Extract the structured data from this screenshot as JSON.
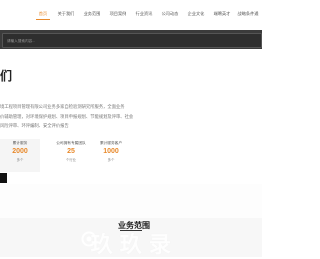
{
  "nav": {
    "items": [
      {
        "label": "首页",
        "active": true
      },
      {
        "label": "关于我们"
      },
      {
        "label": "业务范围"
      },
      {
        "label": "项目案例"
      },
      {
        "label": "行业资讯"
      },
      {
        "label": "公司动态"
      },
      {
        "label": "企业文化"
      },
      {
        "label": "端聘英才"
      },
      {
        "label": "战略条件通"
      }
    ]
  },
  "search": {
    "placeholder": "请输入搜索内容..."
  },
  "about": {
    "title": "们",
    "lines": [
      "境工程项目管理有限公司业务多家自检验测研究所服务，全面业务",
      "价辅助管理，对环境保护规划、项目申报规划、节能规划及评审、社会",
      "风险评审、环评编制、安全评价报告"
    ]
  },
  "stats": [
    {
      "label": "累计服务",
      "value": "2000",
      "unit": "多个"
    },
    {
      "label": "公司拥有专属团队",
      "value": "25",
      "unit": "个行业"
    },
    {
      "label": "累计服务客户",
      "value": "1000",
      "unit": "多个"
    }
  ],
  "section": {
    "title": "业务范围"
  },
  "watermark": {
    "text": "玖 玖 录"
  },
  "colors": {
    "accent": "#e8892b",
    "search_bg": "#3b3b3b"
  }
}
